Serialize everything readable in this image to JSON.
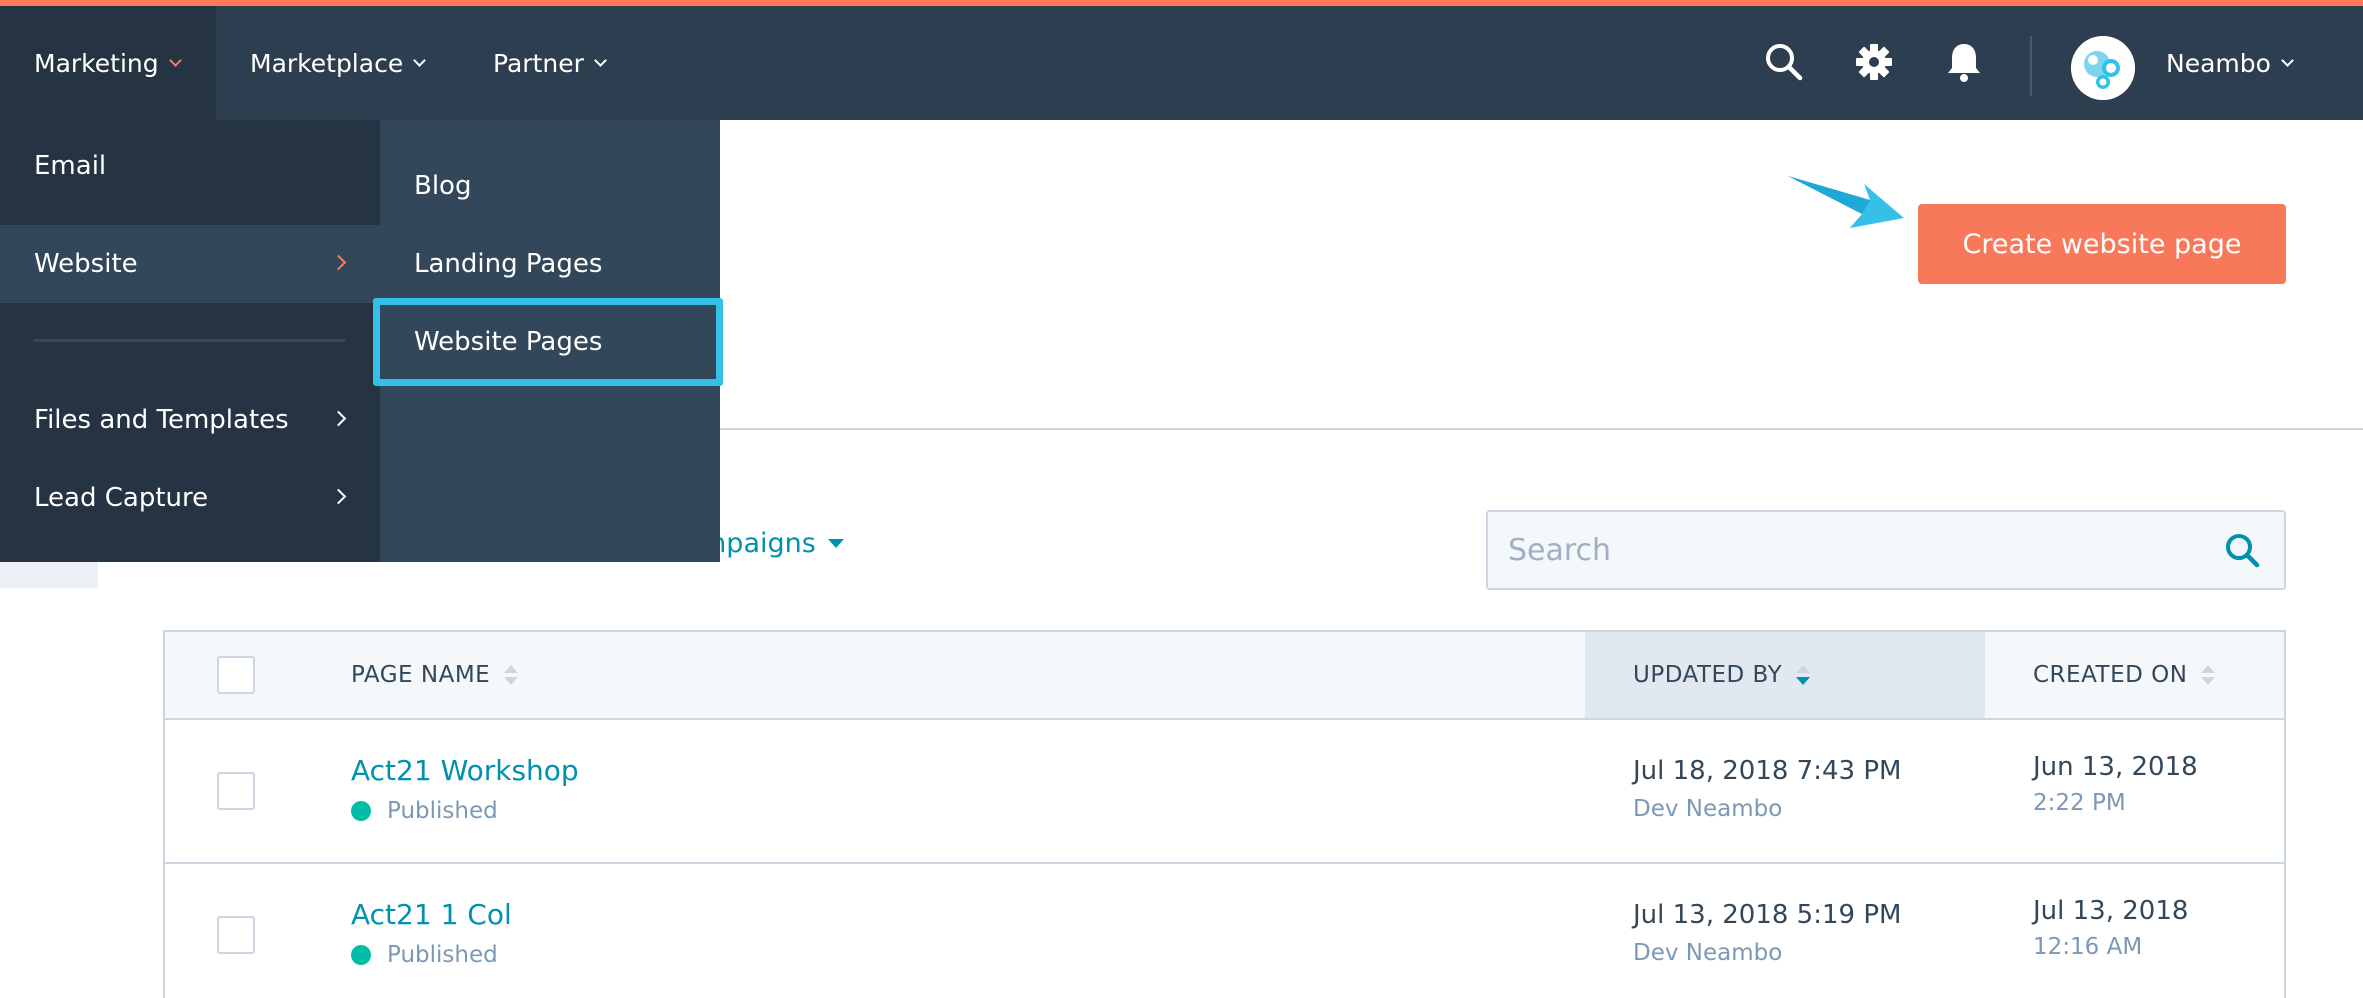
{
  "nav": {
    "items": [
      {
        "label": "Marketing"
      },
      {
        "label": "Marketplace"
      },
      {
        "label": "Partner"
      }
    ],
    "user_name": "Neambo",
    "icons": [
      "search-icon",
      "gear-icon",
      "bell-icon"
    ]
  },
  "menu": {
    "primary": [
      {
        "label": "Email"
      },
      {
        "label": "Website"
      },
      {
        "label": "Files and Templates"
      },
      {
        "label": "Lead Capture"
      }
    ],
    "secondary": [
      {
        "label": "Blog"
      },
      {
        "label": "Landing Pages"
      },
      {
        "label": "Website Pages"
      }
    ]
  },
  "header": {
    "create_button": "Create website page"
  },
  "filters": {
    "campaigns_label": "mpaigns"
  },
  "search": {
    "placeholder": "Search",
    "value": ""
  },
  "table": {
    "columns": [
      "PAGE NAME",
      "UPDATED BY",
      "CREATED ON"
    ],
    "rows": [
      {
        "name": "Act21 Workshop",
        "status": "Published",
        "updated": "Jul 18, 2018 7:43 PM",
        "updated_by": "Dev Neambo",
        "created_date": "Jun 13, 2018",
        "created_time": "2:22 PM"
      },
      {
        "name": "Act21 1 Col",
        "status": "Published",
        "updated": "Jul 13, 2018 5:19 PM",
        "updated_by": "Dev Neambo",
        "created_date": "Jul 13, 2018",
        "created_time": "12:16 AM"
      }
    ]
  },
  "colors": {
    "nav_bg": "#2d3e50",
    "accent": "#ff7a59",
    "link": "#0091ae",
    "highlight": "#35c0e8",
    "published": "#00bda5"
  }
}
